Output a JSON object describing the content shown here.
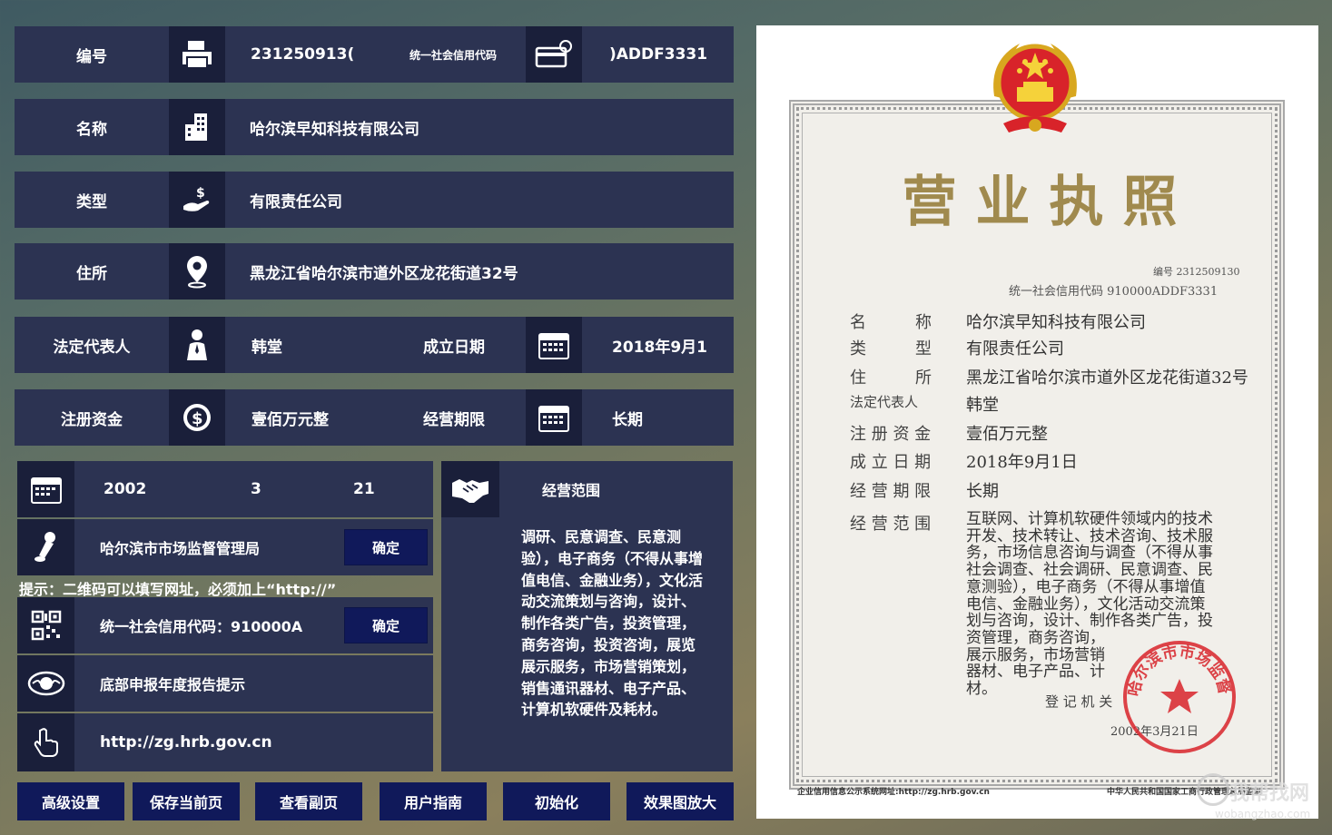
{
  "form": {
    "id_label": "编号",
    "id_value": "231250913(",
    "credit_label": "统一社会信用代码",
    "credit_value": ")ADDF3331",
    "name_label": "名称",
    "name_value": "哈尔滨早知科技有限公司",
    "type_label": "类型",
    "type_value": "有限责任公司",
    "address_label": "住所",
    "address_value": "黑龙江省哈尔滨市道外区龙花街道32号",
    "rep_label": "法定代表人",
    "rep_value": "韩堂",
    "est_label": "成立日期",
    "est_value": "2018年9月1",
    "capital_label": "注册资金",
    "capital_value": "壹佰万元整",
    "term_label": "经营期限",
    "term_value": "长期"
  },
  "lower": {
    "year": "2002",
    "month": "3",
    "day": "21",
    "authority": "哈尔滨市市场监督管理局",
    "confirm1": "确定",
    "hint": "提示：二维码可以填写网址，必须加上“http://”",
    "qr_text": "统一社会信用代码：910000A",
    "confirm2": "确定",
    "annual_report": "底部申报年度报告提示",
    "url": "http://zg.hrb.gov.cn",
    "scope_title": "经营范围",
    "scope_text": "调研、民意调查、民意测验），电子商务（不得从事增值电信、金融业务），文化活动交流策划与咨询，设计、制作各类广告，投资管理，商务咨询，投资咨询，展览展示服务，市场营销策划，销售通讯器材、电子产品、计算机软硬件及耗材。"
  },
  "buttons": {
    "advanced": "高级设置",
    "save": "保存当前页",
    "view": "查看副页",
    "guide": "用户指南",
    "init": "初始化",
    "zoom": "效果图放大"
  },
  "license": {
    "title": "营 业 执 照",
    "number": "编号 2312509130",
    "credit": "统一社会信用代码 910000ADDF3331",
    "k_name": "名　　　称",
    "v_name": "哈尔滨早知科技有限公司",
    "k_type": "类　　　型",
    "v_type": "有限责任公司",
    "k_addr": "住　　　所",
    "v_addr": "黑龙江省哈尔滨市道外区龙花街道32号",
    "k_rep": "法定代表人",
    "v_rep": "韩堂",
    "k_cap": "注 册 资 金",
    "v_cap": "壹佰万元整",
    "k_est": "成 立 日 期",
    "v_est": "2018年9月1日",
    "k_term": "经 营 期 限",
    "v_term": "长期",
    "k_scope": "经 营 范 围",
    "scope_lines": [
      "互联网、计算机软硬件领域内的技术",
      "开发、技术转让、技术咨询、技术服",
      "务，市场信息咨询与调查（不得从事",
      "社会调查、社会调研、民意调查、民",
      "意测验），电子商务（不得从事增值",
      "电信、金融业务），文化活动交流策",
      "划与咨询，设计、制作各类广告，投",
      "资管理，商务咨询，",
      "展示服务，市场营销",
      "器材、电子产品、计",
      "材。"
    ],
    "registrar": "登 记 机 关",
    "date": "2002年3月21日",
    "footer_left": "企业信用信息公示系统网址:http://zg.hrb.gov.cn",
    "footer_right": "中华人民共和国国家工商行政管理总局监制",
    "stamp_text": "哈尔滨市市场监督管理局"
  },
  "watermark": {
    "cn": "我帮找网",
    "url": "wobangzhao.com"
  },
  "colors": {
    "panel": "#2c3352",
    "icon_bg": "#1a1f3a",
    "button": "#10195a",
    "title_gold": "#a08a4e",
    "stamp_red": "#d8232a"
  }
}
